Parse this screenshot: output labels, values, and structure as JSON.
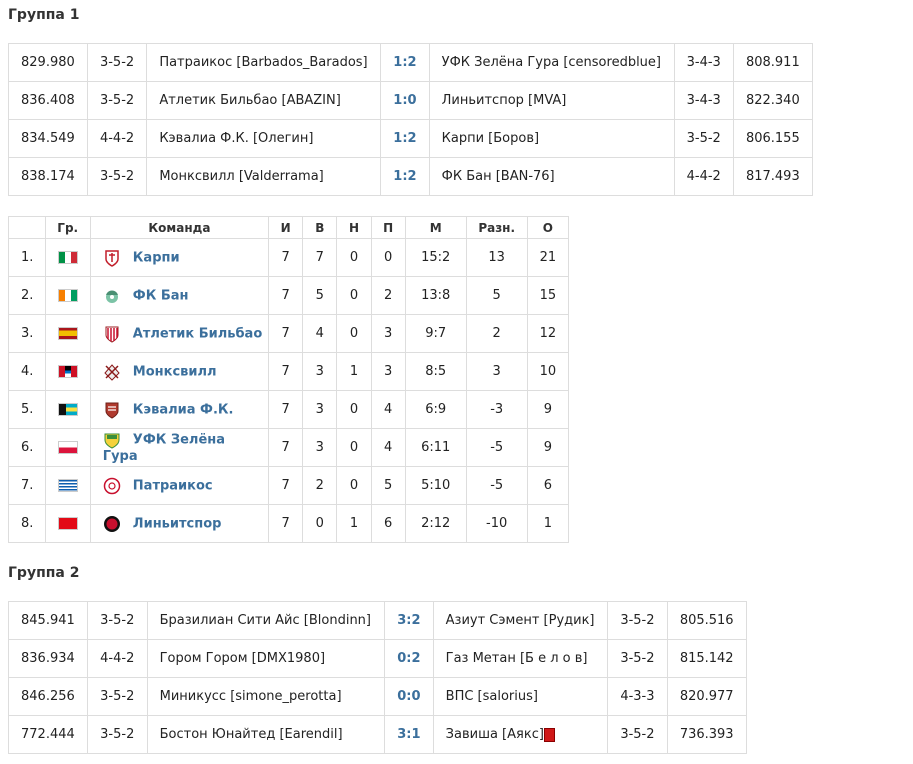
{
  "group1": {
    "title": "Группа 1",
    "matches": [
      {
        "home_rating": "829.980",
        "home_formation": "3-5-2",
        "home": "Патраикос [Barbados_Barados]",
        "score": "1:2",
        "away": "УФК Зелёна Гура [censoredblue]",
        "away_formation": "3-4-3",
        "away_rating": "808.911"
      },
      {
        "home_rating": "836.408",
        "home_formation": "3-5-2",
        "home": "Атлетик Бильбао [ABAZIN]",
        "score": "1:0",
        "away": "Линьитспор [MVA]",
        "away_formation": "3-4-3",
        "away_rating": "822.340"
      },
      {
        "home_rating": "834.549",
        "home_formation": "4-4-2",
        "home": "Кэвалиа Ф.К. [Олегин]",
        "score": "1:2",
        "away": "Карпи [Боров]",
        "away_formation": "3-5-2",
        "away_rating": "806.155"
      },
      {
        "home_rating": "838.174",
        "home_formation": "3-5-2",
        "home": "Монксвилл [Valderrama]",
        "score": "1:2",
        "away": "ФК Бан [BAN-76]",
        "away_formation": "4-4-2",
        "away_rating": "817.493"
      }
    ],
    "standings": {
      "headers": {
        "country": "Гр.",
        "team": "Команда",
        "played": "И",
        "won": "В",
        "drawn": "Н",
        "lost": "П",
        "goals": "М",
        "diff": "Разн.",
        "points": "О"
      },
      "rows": [
        {
          "pos": "1.",
          "flag": "italy",
          "crest": "carpi-crest",
          "team": "Карпи",
          "p": "7",
          "w": "7",
          "d": "0",
          "l": "0",
          "g": "15:2",
          "diff": "13",
          "pts": "21"
        },
        {
          "pos": "2.",
          "flag": "ivory-coast",
          "crest": "ban-crest",
          "team": "ФК Бан",
          "p": "7",
          "w": "5",
          "d": "0",
          "l": "2",
          "g": "13:8",
          "diff": "5",
          "pts": "15"
        },
        {
          "pos": "3.",
          "flag": "spain",
          "crest": "athletic-crest",
          "team": "Атлетик Бильбао",
          "p": "7",
          "w": "4",
          "d": "0",
          "l": "3",
          "g": "9:7",
          "diff": "2",
          "pts": "12"
        },
        {
          "pos": "4.",
          "flag": "antigua",
          "crest": "monksville-crest",
          "team": "Монксвилл",
          "p": "7",
          "w": "3",
          "d": "1",
          "l": "3",
          "g": "8:5",
          "diff": "3",
          "pts": "10"
        },
        {
          "pos": "5.",
          "flag": "bahamas",
          "crest": "cavalier-crest",
          "team": "Кэвалиа Ф.К.",
          "p": "7",
          "w": "3",
          "d": "0",
          "l": "4",
          "g": "6:9",
          "diff": "-3",
          "pts": "9"
        },
        {
          "pos": "6.",
          "flag": "poland",
          "crest": "ukp-crest",
          "team": "УФК Зелёна Гура",
          "p": "7",
          "w": "3",
          "d": "0",
          "l": "4",
          "g": "6:11",
          "diff": "-5",
          "pts": "9"
        },
        {
          "pos": "7.",
          "flag": "greece",
          "crest": "patraikos-crest",
          "team": "Патраикос",
          "p": "7",
          "w": "2",
          "d": "0",
          "l": "5",
          "g": "5:10",
          "diff": "-5",
          "pts": "6"
        },
        {
          "pos": "8.",
          "flag": "turkey",
          "crest": "linyitspor-crest",
          "team": "Линьитспор",
          "p": "7",
          "w": "0",
          "d": "1",
          "l": "6",
          "g": "2:12",
          "diff": "-10",
          "pts": "1"
        }
      ]
    }
  },
  "group2": {
    "title": "Группа 2",
    "matches": [
      {
        "home_rating": "845.941",
        "home_formation": "3-5-2",
        "home": "Бразилиан Сити Айс [Blondinn]",
        "score": "3:2",
        "away": "Азиут Сэмент [Рудик]",
        "away_formation": "3-5-2",
        "away_rating": "805.516"
      },
      {
        "home_rating": "836.934",
        "home_formation": "4-4-2",
        "home": "Гором Гором [DMX1980]",
        "score": "0:2",
        "away": "Газ Метан [Б е л о в]",
        "away_formation": "3-5-2",
        "away_rating": "815.142"
      },
      {
        "home_rating": "846.256",
        "home_formation": "3-5-2",
        "home": "Миникусс [simone_perotta]",
        "score": "0:0",
        "away": "ВПС [salorius]",
        "away_formation": "4-3-3",
        "away_rating": "820.977"
      },
      {
        "home_rating": "772.444",
        "home_formation": "3-5-2",
        "home": "Бостон Юнайтед [Earendil]",
        "score": "3:1",
        "away": "Завиша [Аякс]",
        "away_formation": "3-5-2",
        "away_rating": "736.393",
        "away_card": "red-card-icon"
      }
    ]
  },
  "colors": {
    "link": "#3b6f9c",
    "border": "#dddddd",
    "red_card": "#d01818"
  }
}
